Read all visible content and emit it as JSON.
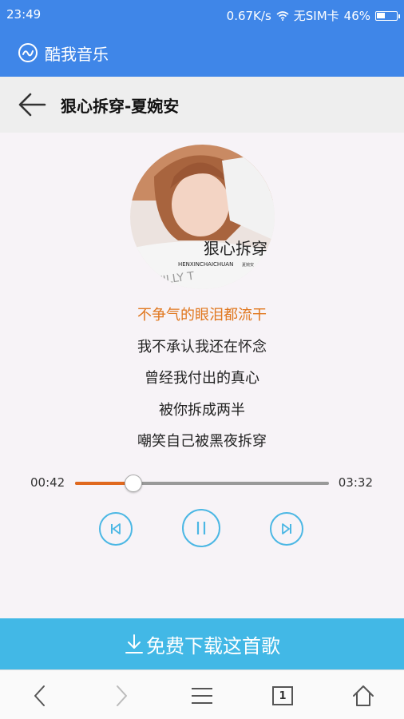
{
  "status_bar": {
    "time": "23:49",
    "speed": "0.67K/s",
    "sim": "无SIM卡",
    "battery": "46%",
    "battery_level": 0.46,
    "icons": [
      "wifi-icon",
      "battery-icon"
    ]
  },
  "app_bar": {
    "title": "酷我音乐",
    "logo_icon": "kuwo-logo-icon"
  },
  "song_bar": {
    "title": "狠心拆穿-夏婉安",
    "back_icon": "arrow-left-icon"
  },
  "cover": {
    "title_art": "狠心拆穿",
    "pinyin_art": "HENXINCHAICHUAN",
    "artist_art": "夏婉安"
  },
  "lyrics": [
    "不争气的眼泪都流干",
    "我不承认我还在怀念",
    "曾经我付出的真心",
    "被你拆成两半",
    "嘲笑自己被黑夜拆穿"
  ],
  "lyrics_current_index": 0,
  "playback": {
    "current_time": "00:42",
    "total_time": "03:32",
    "progress": 0.23
  },
  "controls": [
    "previous-icon",
    "pause-icon",
    "next-icon"
  ],
  "download": {
    "label": "免费下载这首歌",
    "icon": "download-icon"
  },
  "nav": {
    "tabs_count": "1",
    "icons": [
      "back-icon",
      "forward-icon",
      "menu-icon",
      "tabs-icon",
      "home-icon"
    ]
  },
  "colors": {
    "primary": "#3f86e8",
    "accent_lyric": "#e0771e",
    "progress_played": "#e0681e",
    "control": "#4bb7e4",
    "download": "#42b8e6"
  }
}
